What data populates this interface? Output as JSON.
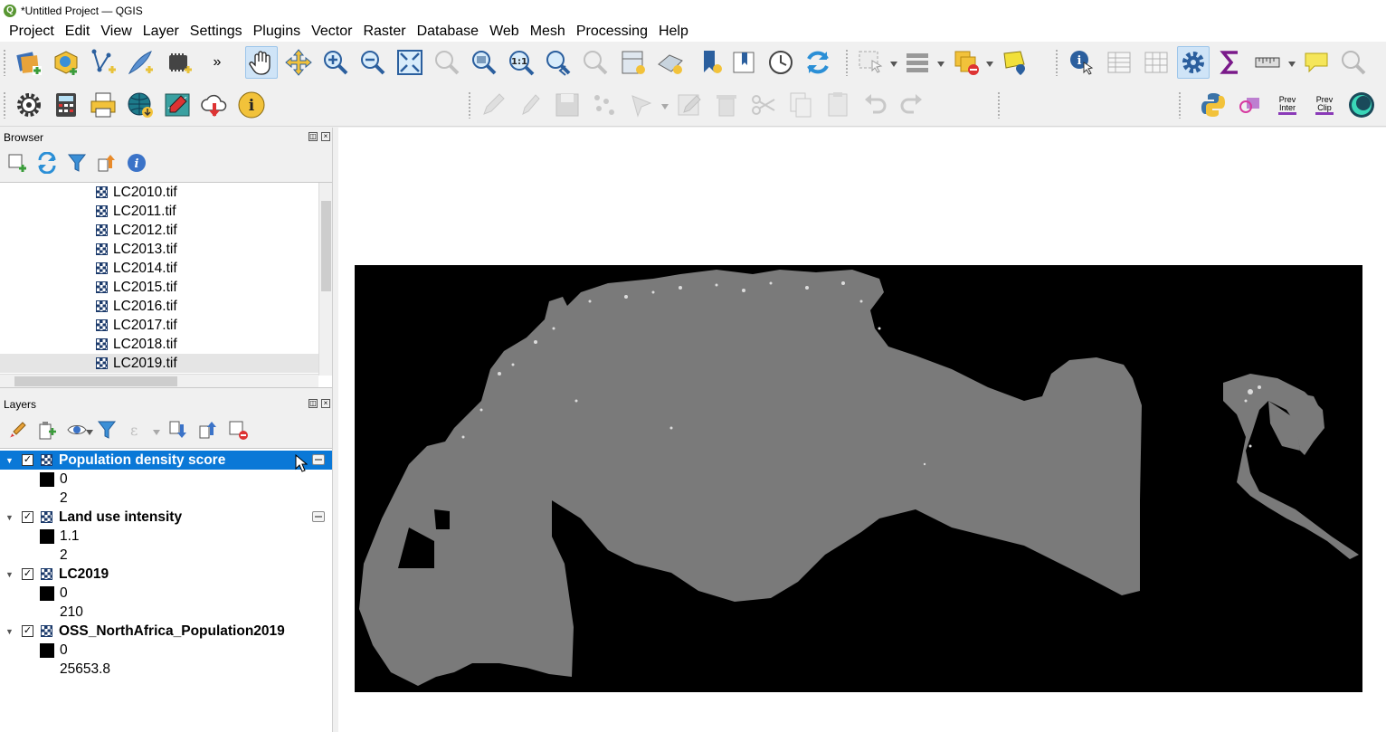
{
  "window": {
    "title": "*Untitled Project — QGIS"
  },
  "menu": [
    "Project",
    "Edit",
    "View",
    "Layer",
    "Settings",
    "Plugins",
    "Vector",
    "Raster",
    "Database",
    "Web",
    "Mesh",
    "Processing",
    "Help"
  ],
  "toolbar": {
    "overflow_label": "»"
  },
  "plugins": {
    "prev_inter": "Prev Inter",
    "prev_clip": "Prev Clip"
  },
  "browser": {
    "title": "Browser",
    "items": [
      "LC2010.tif",
      "LC2011.tif",
      "LC2012.tif",
      "LC2013.tif",
      "LC2014.tif",
      "LC2015.tif",
      "LC2016.tif",
      "LC2017.tif",
      "LC2018.tif",
      "LC2019.tif"
    ],
    "selected_item": "LC2019.tif"
  },
  "layers": {
    "title": "Layers",
    "items": [
      {
        "name": "Population density score",
        "checked": true,
        "selected": true,
        "legend": [
          "0",
          "2"
        ]
      },
      {
        "name": "Land use intensity",
        "checked": true,
        "selected": false,
        "legend": [
          "1.1",
          "2"
        ]
      },
      {
        "name": "LC2019",
        "checked": true,
        "selected": false,
        "legend": [
          "0",
          "210"
        ]
      },
      {
        "name": "OSS_NorthAfrica_Population2019",
        "checked": true,
        "selected": false,
        "legend": [
          "0",
          "25653.8"
        ]
      }
    ]
  },
  "colors": {
    "selection": "#0a78d7",
    "raster_background": "#000000",
    "raster_land": "#7a7a7a"
  }
}
